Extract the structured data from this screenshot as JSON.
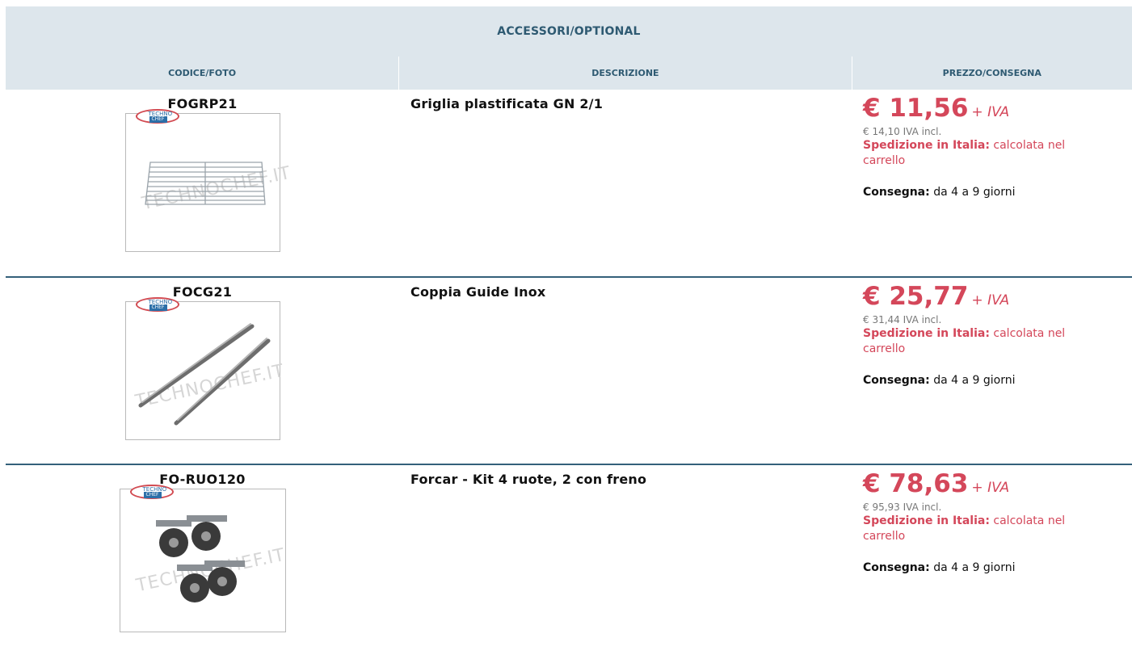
{
  "table": {
    "title": "ACCESSORI/OPTIONAL",
    "headers": {
      "code": "CODICE/FOTO",
      "description": "DESCRIZIONE",
      "price": "PREZZO/CONSEGNA"
    }
  },
  "logo": {
    "top": "TECHNO",
    "bottom": "CHEF"
  },
  "watermark": "TECHNOCHEF.IT",
  "items": [
    {
      "code": "FOGRP21",
      "description": "Griglia plastificata GN 2/1",
      "price": "€ 11,56",
      "iva_label": "+ IVA",
      "price_incl": "€ 14,10 IVA incl.",
      "shipping_label": "Spedizione in Italia:",
      "shipping_value": "calcolata nel carrello",
      "delivery_label": "Consegna:",
      "delivery_value": "da 4 a 9 giorni",
      "image_icon": "wire-grid-icon"
    },
    {
      "code": "FOCG21",
      "description": "Coppia Guide Inox",
      "price": "€ 25,77",
      "iva_label": "+ IVA",
      "price_incl": "€ 31,44 IVA incl.",
      "shipping_label": "Spedizione in Italia:",
      "shipping_value": "calcolata nel carrello",
      "delivery_label": "Consegna:",
      "delivery_value": "da 4 a 9 giorni",
      "image_icon": "rail-guides-icon"
    },
    {
      "code": "FO-RUO120",
      "description": "Forcar - Kit 4 ruote, 2 con freno",
      "price": "€ 78,63",
      "iva_label": "+ IVA",
      "price_incl": "€ 95,93 IVA incl.",
      "shipping_label": "Spedizione in Italia:",
      "shipping_value": "calcolata nel carrello",
      "delivery_label": "Consegna:",
      "delivery_value": "da 4 a 9 giorni",
      "image_icon": "caster-wheels-icon"
    }
  ],
  "colors": {
    "header_bg": "#dde6ec",
    "header_text": "#2e5a72",
    "price": "#d4475a",
    "separator": "#34607a"
  }
}
